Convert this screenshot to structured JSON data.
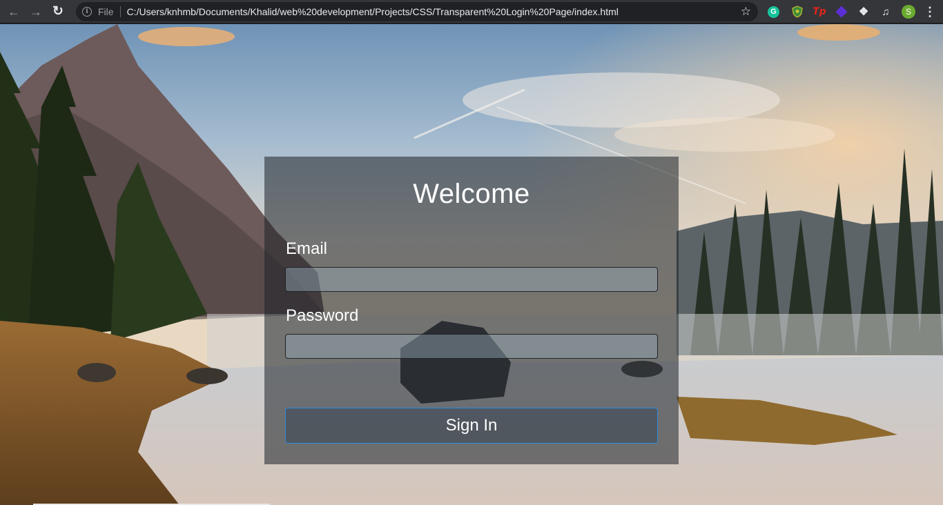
{
  "browser": {
    "scheme_label": "File",
    "url": "C:/Users/knhmb/Documents/Khalid/web%20development/Projects/CSS/Transparent%20Login%20Page/index.html",
    "nav_icons": [
      "back-arrow-icon",
      "forward-arrow-icon",
      "reload-icon"
    ],
    "extensions": [
      "grammarly-icon",
      "shield-extension-icon",
      "tp-extension-icon",
      "diamond-extension-icon",
      "puzzle-icon",
      "media-control-icon"
    ],
    "profile_initial": "S",
    "grammarly_letter": "G",
    "tp_label": "Tp"
  },
  "login": {
    "title": "Welcome",
    "email_label": "Email",
    "email_value": "",
    "password_label": "Password",
    "password_value": "",
    "button_label": "Sign In"
  },
  "colors": {
    "card_overlay": "rgba(30,34,40,0.55)",
    "button_border": "#2a8be0",
    "chrome_toolbar": "#35363a",
    "omnibox": "#202124"
  }
}
